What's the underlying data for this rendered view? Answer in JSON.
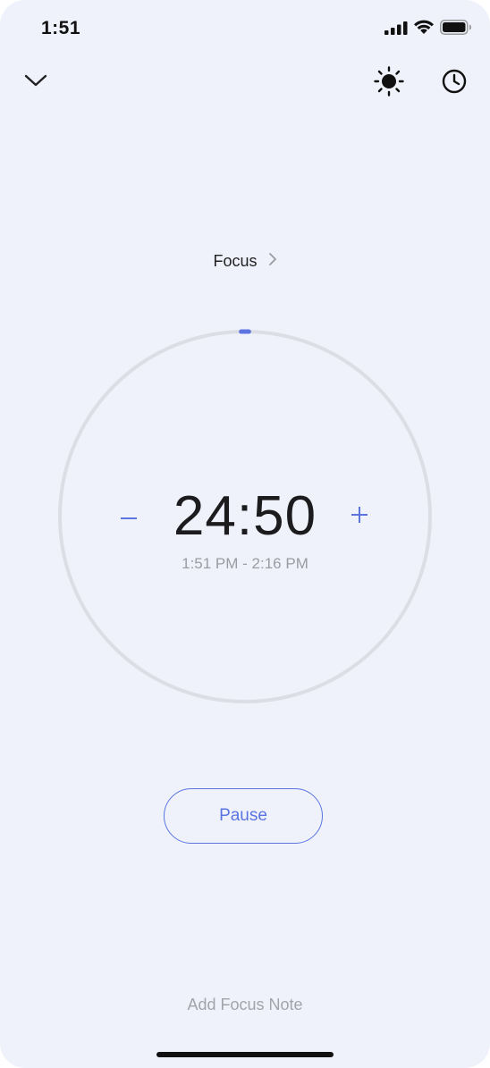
{
  "status_bar": {
    "time": "1:51"
  },
  "toolbar": {
    "collapse_icon": "chevron-down-icon",
    "brightness_icon": "sun-icon",
    "history_icon": "clock-icon"
  },
  "mode": {
    "label": "Focus",
    "chevron_icon": "chevron-right-icon"
  },
  "timer": {
    "remaining": "24:50",
    "range": "1:51 PM - 2:16 PM",
    "decrease_icon": "minus-icon",
    "increase_icon": "plus-icon",
    "progress_fraction": 0.0067
  },
  "controls": {
    "pause_label": "Pause"
  },
  "footer": {
    "note_label": "Add Focus Note"
  },
  "colors": {
    "accent": "#5b74e0",
    "background": "#f0f2fb",
    "ring_track": "#dcdee5"
  }
}
